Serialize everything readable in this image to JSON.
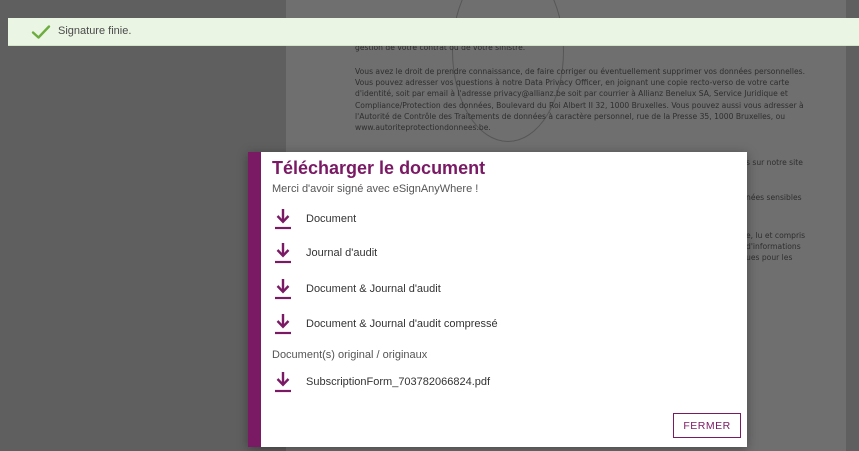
{
  "background": {
    "paragraphs": [
      "gestion de votre contrat ou de votre sinistre.",
      "Vous avez le droit de prendre connaissance, de faire corriger ou éventuellement supprimer vos données personnelles. Vous pouvez adresser vos questions à notre Data Privacy Officer, en joignant une copie recto-verso de votre carte d'identité, soit par email à l'adresse privacy@allianz.be soit par courrier à Allianz Benelux SA, Service Juridique et Compliance/Protection des données, Boulevard du Roi Albert II 32, 1000 Bruxelles. Vous pouvez aussi vous adresser à l'Autorité de Contrôle des Traitements de données à caractère personnel, rue de la Presse 35, 1000 Bruxelles, ou www.autoriteprotectiondonnees.be."
    ],
    "side_fragments": [
      "s sur notre site",
      "nées sensibles",
      "e, lu et compris",
      "d'informations",
      "ues pour les"
    ]
  },
  "notification": {
    "text": "Signature finie.",
    "icon": "check-icon",
    "color": "#eaf5e4"
  },
  "dialog": {
    "title": "Télécharger le document",
    "subtitle": "Merci d'avoir signé avec eSignAnyWhere !",
    "downloads": [
      {
        "label": "Document",
        "icon": "download-icon"
      },
      {
        "label": "Journal d'audit",
        "icon": "download-icon"
      },
      {
        "label": "Document & Journal d'audit",
        "icon": "download-icon"
      },
      {
        "label": "Document & Journal d'audit compressé",
        "icon": "download-icon"
      }
    ],
    "originals_label": "Document(s) original / originaux",
    "originals": [
      {
        "label": "SubscriptionForm_703782066824.pdf",
        "icon": "download-icon"
      }
    ],
    "close_label": "FERMER",
    "accent_color": "#7a1a64"
  }
}
